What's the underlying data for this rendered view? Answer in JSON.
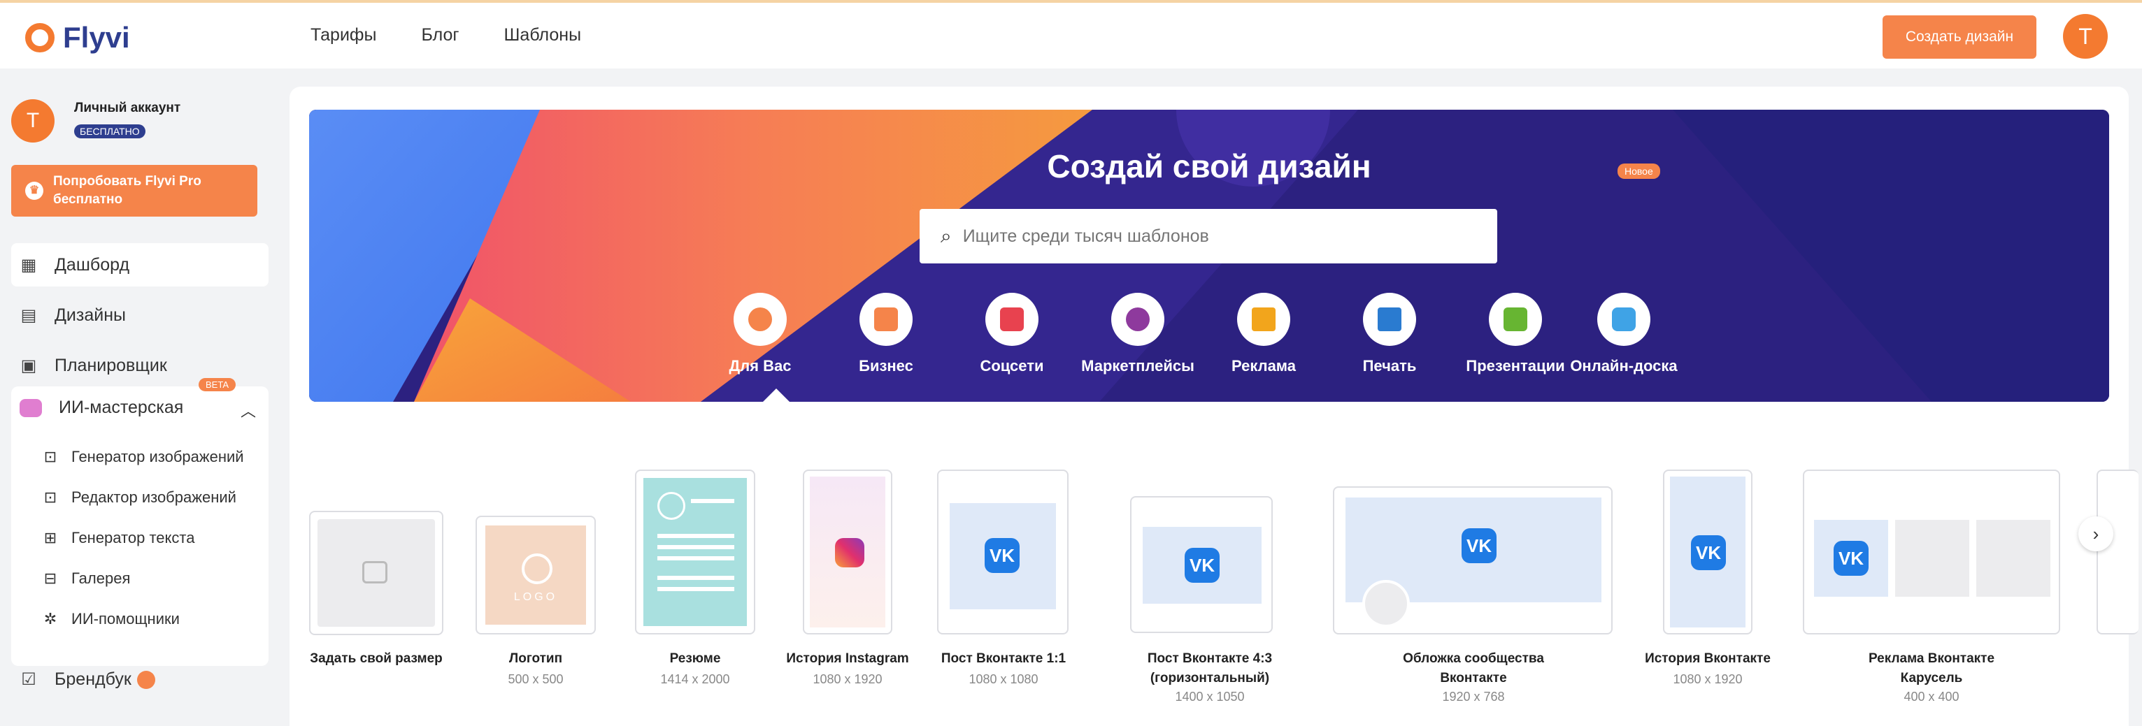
{
  "brand": {
    "name": "Flyvi"
  },
  "nav": {
    "items": [
      "Тарифы",
      "Блог",
      "Шаблоны"
    ]
  },
  "header": {
    "create_label": "Создать дизайн",
    "user_initial": "T"
  },
  "account": {
    "initial": "T",
    "name": "Личный аккаунт",
    "plan": "БЕСПЛАТНО"
  },
  "promo": {
    "label": "Попробовать Flyvi Pro бесплатно",
    "icon": "crown-icon"
  },
  "sidebar": {
    "items": [
      {
        "label": "Дашборд",
        "icon": "grid-icon"
      },
      {
        "label": "Дизайны",
        "icon": "designs-icon"
      },
      {
        "label": "Планировщик",
        "icon": "calendar-icon"
      }
    ],
    "ai": {
      "label": "ИИ-мастерская",
      "badge": "BETA",
      "items": [
        {
          "label": "Генератор изображений",
          "icon": "image-generator-icon"
        },
        {
          "label": "Редактор изображений",
          "icon": "image-editor-icon"
        },
        {
          "label": "Генератор текста",
          "icon": "text-generator-icon"
        },
        {
          "label": "Галерея",
          "icon": "gallery-icon"
        },
        {
          "label": "ИИ-помощники",
          "icon": "assistant-icon"
        }
      ]
    },
    "brandbook": {
      "label": "Брендбук",
      "icon": "brandbook-icon"
    }
  },
  "hero": {
    "title": "Создай свой дизайн",
    "search_placeholder": "Ищите среди тысяч шаблонов",
    "new_badge": "Новое",
    "categories": [
      {
        "label": "Для Вас",
        "color": "#f5844a"
      },
      {
        "label": "Бизнес",
        "color": "#f5844a"
      },
      {
        "label": "Соцсети",
        "color": "#e8424f"
      },
      {
        "label": "Маркетплейсы",
        "color": "#8e3a9d"
      },
      {
        "label": "Реклама",
        "color": "#f2a51c"
      },
      {
        "label": "Печать",
        "color": "#2a7bd0"
      },
      {
        "label": "Презентации",
        "color": "#67b532"
      },
      {
        "label": "Онлайн-доска",
        "color": "#3fa3e6"
      }
    ]
  },
  "templates": [
    {
      "label": "Задать свой размер",
      "size": ""
    },
    {
      "label": "Логотип",
      "size": "500 x 500",
      "logo_text": "LOGO"
    },
    {
      "label": "Резюме",
      "size": "1414 x 2000"
    },
    {
      "label": "История Instagram",
      "size": "1080 x 1920"
    },
    {
      "label": "Пост Вконтакте 1:1",
      "size": "1080 x 1080"
    },
    {
      "label": "Пост Вконтакте 4:3 (горизонтальный)",
      "size": "1400 x 1050"
    },
    {
      "label": "Обложка сообщества Вконтакте",
      "size": "1920 x 768"
    },
    {
      "label": "История Вконтакте",
      "size": "1080 x 1920"
    },
    {
      "label": "Реклама Вконтакте Карусель",
      "size": "400 x 400"
    }
  ],
  "colors": {
    "accent": "#f5844a",
    "brand_blue": "#2e3e8f",
    "vk_blue": "#1f7be4"
  }
}
